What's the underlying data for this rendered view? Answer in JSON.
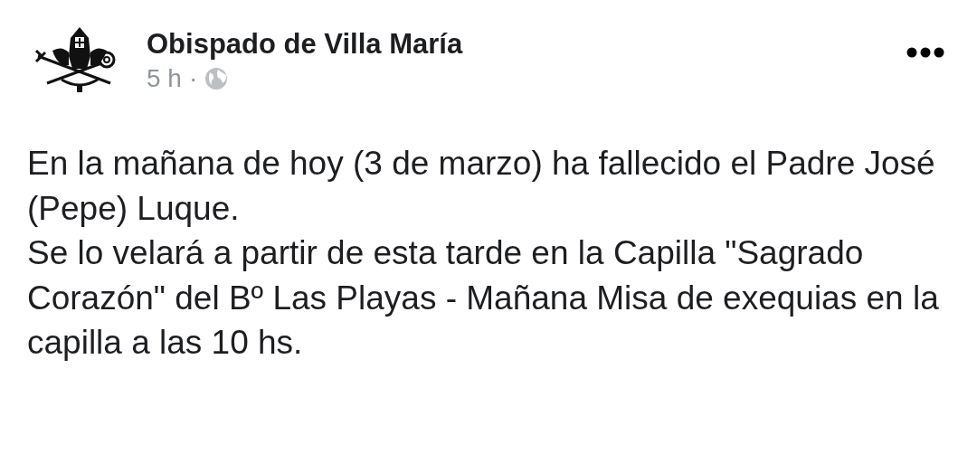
{
  "post": {
    "author": "Obispado de Villa María",
    "time": "5 h",
    "separator": "·",
    "text": "En la mañana de hoy (3 de marzo) ha fallecido el Padre José (Pepe) Luque.\nSe lo velará a partir de esta tarde en la Capilla \"Sagrado Corazón\" del Bº Las Playas - Mañana Misa de exequias en la capilla a las 10 hs."
  }
}
